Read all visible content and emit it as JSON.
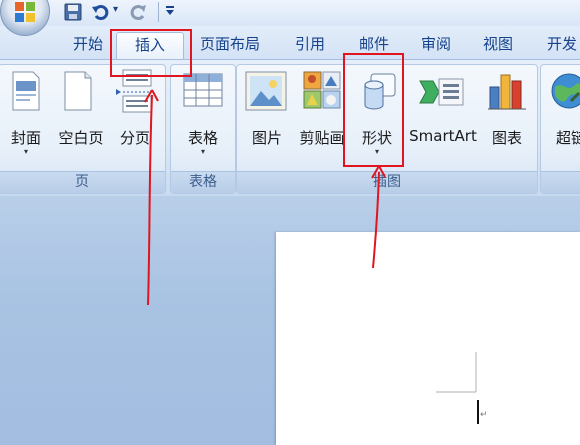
{
  "titlebar": {
    "office_button_icon": "office-logo-icon",
    "qat": [
      {
        "name": "save-icon",
        "glyph": "💾"
      },
      {
        "name": "undo-icon",
        "glyph": "↶"
      },
      {
        "name": "redo-icon",
        "glyph": "↻"
      }
    ]
  },
  "tabs": [
    {
      "label": "开始",
      "active": false
    },
    {
      "label": "插入",
      "active": true
    },
    {
      "label": "页面布局",
      "active": false
    },
    {
      "label": "引用",
      "active": false
    },
    {
      "label": "邮件",
      "active": false
    },
    {
      "label": "审阅",
      "active": false
    },
    {
      "label": "视图",
      "active": false
    },
    {
      "label": "开发",
      "active": false
    }
  ],
  "groups": [
    {
      "label": "页",
      "commands": [
        {
          "label": "封面",
          "icon": "cover-page-icon",
          "dropdown": true
        },
        {
          "label": "空白页",
          "icon": "blank-page-icon",
          "dropdown": false
        },
        {
          "label": "分页",
          "icon": "page-break-icon",
          "dropdown": false
        }
      ]
    },
    {
      "label": "表格",
      "commands": [
        {
          "label": "表格",
          "icon": "table-icon",
          "dropdown": true
        }
      ]
    },
    {
      "label": "插图",
      "commands": [
        {
          "label": "图片",
          "icon": "picture-icon",
          "dropdown": false
        },
        {
          "label": "剪贴画",
          "icon": "clip-art-icon",
          "dropdown": false
        },
        {
          "label": "形状",
          "icon": "shapes-icon",
          "dropdown": true
        },
        {
          "label": "SmartArt",
          "icon": "smartart-icon",
          "dropdown": false
        },
        {
          "label": "图表",
          "icon": "chart-icon",
          "dropdown": false
        }
      ]
    },
    {
      "label": "",
      "commands": [
        {
          "label": "超链",
          "icon": "hyperlink-icon",
          "dropdown": false
        }
      ]
    }
  ],
  "caret_glyph": "▾",
  "paragraph_mark": "↵",
  "colors": {
    "accent_text": "#15428b",
    "annotation_red": "#e0151f"
  }
}
